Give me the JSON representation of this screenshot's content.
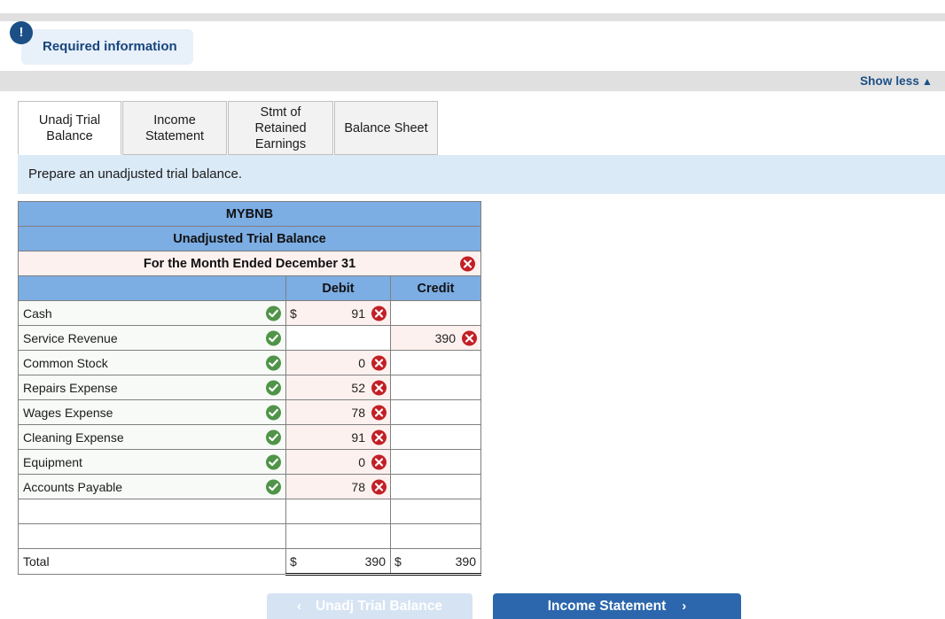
{
  "banner": {
    "icon": "exclamation-icon",
    "label": "Required information"
  },
  "toolbar": {
    "show_less_label": "Show less",
    "show_less_caret": "▲"
  },
  "tabs": [
    {
      "label": "Unadj Trial Balance",
      "active": true
    },
    {
      "label": "Income Statement",
      "active": false
    },
    {
      "label": "Stmt of Retained Earnings",
      "active": false
    },
    {
      "label": "Balance Sheet",
      "active": false
    }
  ],
  "instruction": "Prepare an unadjusted trial balance.",
  "worksheet": {
    "company": "MYBNB",
    "statement": "Unadjusted Trial Balance",
    "period": "For the Month Ended December 31",
    "period_status": "incorrect",
    "columns": {
      "blank": "",
      "debit": "Debit",
      "credit": "Credit"
    },
    "rows": [
      {
        "account": "Cash",
        "account_status": "correct",
        "debit": "91",
        "debit_prefix": "$",
        "debit_status": "incorrect",
        "credit": "",
        "credit_prefix": "",
        "credit_status": "none"
      },
      {
        "account": "Service Revenue",
        "account_status": "correct",
        "debit": "",
        "debit_prefix": "",
        "debit_status": "none",
        "credit": "390",
        "credit_prefix": "",
        "credit_status": "incorrect"
      },
      {
        "account": "Common Stock",
        "account_status": "correct",
        "debit": "0",
        "debit_prefix": "",
        "debit_status": "incorrect",
        "credit": "",
        "credit_prefix": "",
        "credit_status": "none"
      },
      {
        "account": "Repairs Expense",
        "account_status": "correct",
        "debit": "52",
        "debit_prefix": "",
        "debit_status": "incorrect",
        "credit": "",
        "credit_prefix": "",
        "credit_status": "none"
      },
      {
        "account": "Wages Expense",
        "account_status": "correct",
        "debit": "78",
        "debit_prefix": "",
        "debit_status": "incorrect",
        "credit": "",
        "credit_prefix": "",
        "credit_status": "none"
      },
      {
        "account": "Cleaning Expense",
        "account_status": "correct",
        "debit": "91",
        "debit_prefix": "",
        "debit_status": "incorrect",
        "credit": "",
        "credit_prefix": "",
        "credit_status": "none"
      },
      {
        "account": "Equipment",
        "account_status": "correct",
        "debit": "0",
        "debit_prefix": "",
        "debit_status": "incorrect",
        "credit": "",
        "credit_prefix": "",
        "credit_status": "none"
      },
      {
        "account": "Accounts Payable",
        "account_status": "correct",
        "debit": "78",
        "debit_prefix": "",
        "debit_status": "incorrect",
        "credit": "",
        "credit_prefix": "",
        "credit_status": "none"
      },
      {
        "account": "",
        "account_status": "none",
        "debit": "",
        "debit_prefix": "",
        "debit_status": "none",
        "credit": "",
        "credit_prefix": "",
        "credit_status": "none"
      },
      {
        "account": "",
        "account_status": "none",
        "debit": "",
        "debit_prefix": "",
        "debit_status": "none",
        "credit": "",
        "credit_prefix": "",
        "credit_status": "none"
      }
    ],
    "total": {
      "label": "Total",
      "debit_prefix": "$",
      "debit": "390",
      "credit_prefix": "$",
      "credit": "390"
    }
  },
  "footer": {
    "prev_label": "Unadj Trial Balance",
    "prev_chevron": "‹",
    "next_label": "Income Statement",
    "next_chevron": "›"
  },
  "colors": {
    "header_blue": "#7cadE3",
    "flag_pink": "#fdf1ef",
    "instruction_blue": "#dbeaf7",
    "brand_blue": "#2c67ad",
    "correct_green": "#4f9448",
    "incorrect_red": "#c22026"
  }
}
